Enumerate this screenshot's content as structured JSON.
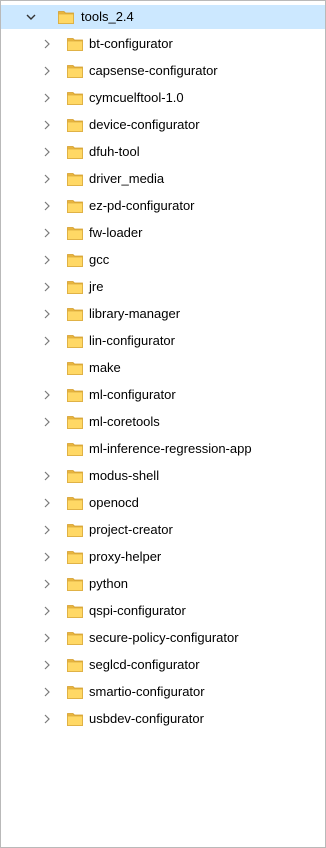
{
  "tree": {
    "root": {
      "label": "tools_2.4",
      "expanded": true,
      "selected": true
    },
    "children": [
      {
        "label": "bt-configurator",
        "expandable": true
      },
      {
        "label": "capsense-configurator",
        "expandable": true
      },
      {
        "label": "cymcuelftool-1.0",
        "expandable": true
      },
      {
        "label": "device-configurator",
        "expandable": true
      },
      {
        "label": "dfuh-tool",
        "expandable": true
      },
      {
        "label": "driver_media",
        "expandable": true
      },
      {
        "label": "ez-pd-configurator",
        "expandable": true
      },
      {
        "label": "fw-loader",
        "expandable": true
      },
      {
        "label": "gcc",
        "expandable": true
      },
      {
        "label": "jre",
        "expandable": true
      },
      {
        "label": "library-manager",
        "expandable": true
      },
      {
        "label": "lin-configurator",
        "expandable": true
      },
      {
        "label": "make",
        "expandable": false
      },
      {
        "label": "ml-configurator",
        "expandable": true
      },
      {
        "label": "ml-coretools",
        "expandable": true
      },
      {
        "label": "ml-inference-regression-app",
        "expandable": false
      },
      {
        "label": "modus-shell",
        "expandable": true
      },
      {
        "label": "openocd",
        "expandable": true
      },
      {
        "label": "project-creator",
        "expandable": true
      },
      {
        "label": "proxy-helper",
        "expandable": true
      },
      {
        "label": "python",
        "expandable": true
      },
      {
        "label": "qspi-configurator",
        "expandable": true
      },
      {
        "label": "secure-policy-configurator",
        "expandable": true
      },
      {
        "label": "seglcd-configurator",
        "expandable": true
      },
      {
        "label": "smartio-configurator",
        "expandable": true
      },
      {
        "label": "usbdev-configurator",
        "expandable": true
      }
    ]
  },
  "icons": {
    "folder": "folder-icon",
    "collapsed": "chevron-right-icon",
    "expanded": "chevron-down-icon"
  },
  "colors": {
    "selection": "#cce8ff",
    "folder_body": "#ffd865",
    "folder_back": "#e8b53e",
    "chevron": "#7a7a7a",
    "chevron_expanded": "#333333",
    "border": "#b9b9b9"
  }
}
